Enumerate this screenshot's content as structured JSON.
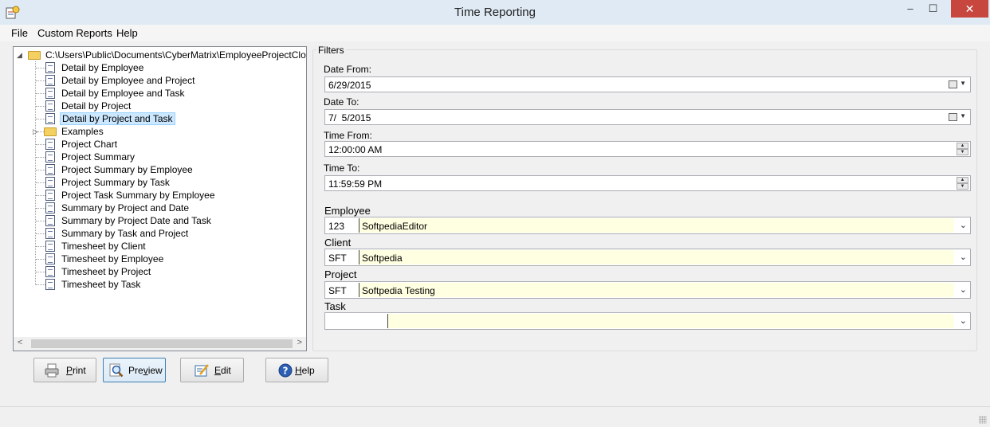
{
  "window": {
    "title": "Time Reporting",
    "minimize": "–",
    "maximize": "☐",
    "close": "✕"
  },
  "menu": [
    "File",
    "Custom Reports",
    "Help"
  ],
  "tree": {
    "root": "C:\\Users\\Public\\Documents\\CyberMatrix\\EmployeeProjectClock\\Repo",
    "items": [
      {
        "label": "Detail by Employee",
        "type": "doc"
      },
      {
        "label": "Detail by Employee and Project",
        "type": "doc"
      },
      {
        "label": "Detail by Employee and Task",
        "type": "doc"
      },
      {
        "label": "Detail by Project",
        "type": "doc"
      },
      {
        "label": "Detail by Project and Task",
        "type": "doc",
        "selected": true
      },
      {
        "label": "Examples",
        "type": "folder"
      },
      {
        "label": "Project Chart",
        "type": "doc"
      },
      {
        "label": "Project Summary",
        "type": "doc"
      },
      {
        "label": "Project Summary by Employee",
        "type": "doc"
      },
      {
        "label": "Project Summary by Task",
        "type": "doc"
      },
      {
        "label": "Project Task Summary by Employee",
        "type": "doc"
      },
      {
        "label": "Summary by Project and Date",
        "type": "doc"
      },
      {
        "label": "Summary by Project Date and Task",
        "type": "doc"
      },
      {
        "label": "Summary by Task and Project",
        "type": "doc"
      },
      {
        "label": "Timesheet by Client",
        "type": "doc"
      },
      {
        "label": "Timesheet by Employee",
        "type": "doc"
      },
      {
        "label": "Timesheet by Project",
        "type": "doc"
      },
      {
        "label": "Timesheet by Task",
        "type": "doc"
      }
    ]
  },
  "filters": {
    "title": "Filters",
    "date_from_label": "Date From:",
    "date_from": "6/29/2015",
    "date_to_label": "Date To:",
    "date_to": "7/  5/2015",
    "time_from_label": "Time From:",
    "time_from": "12:00:00 AM",
    "time_to_label": "Time To:",
    "time_to": "11:59:59 PM",
    "employee_label": "Employee",
    "employee_code": "123",
    "employee_name": "SoftpediaEditor",
    "client_label": "Client",
    "client_code": "SFT",
    "client_name": "Softpedia",
    "project_label": "Project",
    "project_code": "SFT",
    "project_name": "Softpedia Testing",
    "task_label": "Task",
    "task_code": "",
    "task_name": ""
  },
  "buttons": {
    "print": {
      "u": "P",
      "rest": "rint"
    },
    "preview": {
      "pre": "Pre",
      "u": "v",
      "rest": "iew"
    },
    "edit": {
      "u": "E",
      "rest": "dit"
    },
    "help": {
      "u": "H",
      "rest": "elp"
    }
  },
  "colors": {
    "titlebar": "#dfeaf4",
    "close_button": "#c7463e",
    "selection": "#cce8ff",
    "lookup_field": "#ffffe1"
  }
}
